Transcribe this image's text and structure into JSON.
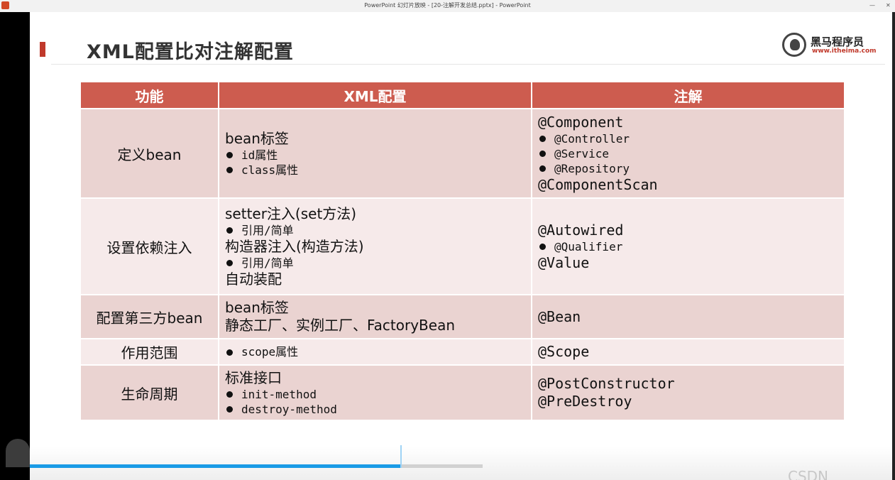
{
  "window": {
    "title": "PowerPoint 幻灯片放映 - [20-注解开发总结.pptx] - PowerPoint",
    "close_label": "✕",
    "minimize_label": "—"
  },
  "slide": {
    "title": "XML配置比对注解配置",
    "logo_name": "黑马程序员",
    "logo_url": "www.itheima.com"
  },
  "table": {
    "headers": [
      "功能",
      "XML配置",
      "注解"
    ],
    "rows": [
      {
        "feature": "定义bean",
        "xml_main1": "bean标签",
        "xml_sub1": "id属性",
        "xml_sub2": "class属性",
        "ann_main1": "@Component",
        "ann_sub1": "@Controller",
        "ann_sub2": "@Service",
        "ann_sub3": "@Repository",
        "ann_main2": "@ComponentScan"
      },
      {
        "feature": "设置依赖注入",
        "xml_main1": "setter注入(set方法)",
        "xml_sub1": "引用/简单",
        "xml_main2": "构造器注入(构造方法)",
        "xml_sub2": "引用/简单",
        "xml_main3": "自动装配",
        "ann_main1": "@Autowired",
        "ann_sub1": "@Qualifier",
        "ann_main2": "@Value"
      },
      {
        "feature": "配置第三方bean",
        "xml_main1": "bean标签",
        "xml_main2": "静态工厂、实例工厂、FactoryBean",
        "ann_main1": "@Bean"
      },
      {
        "feature": "作用范围",
        "xml_sub1": "scope属性",
        "ann_main1": "@Scope"
      },
      {
        "feature": "生命周期",
        "xml_main1": "标准接口",
        "xml_sub1": "init-method",
        "xml_sub2": "destroy-method",
        "ann_main1": "@PostConstructor",
        "ann_main2": "@PreDestroy"
      }
    ]
  },
  "player": {
    "progress_fraction": 0.83
  },
  "watermark": "CSDN @dadoufuk"
}
